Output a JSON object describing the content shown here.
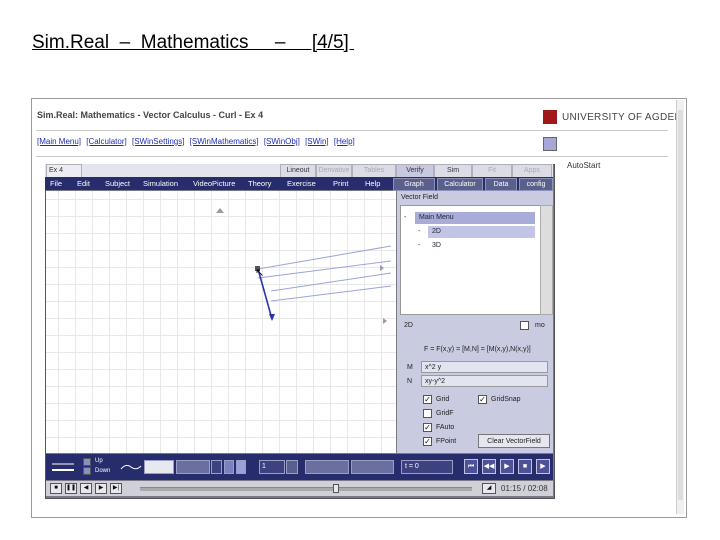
{
  "slide": {
    "title": "Sim.Real  –  Mathematics     –     [4/5] "
  },
  "app": {
    "title": "Sim.Real: Mathematics - Vector Calculus - Curl - Ex 4",
    "university": "UNIVERSITY OF AGDER",
    "nav_links": [
      "[Main Menu]",
      "[Calculator]",
      "[SWinSettings]",
      "[SWinMathematics]",
      "[SWinObj]",
      "[SWin]",
      "[Help]"
    ],
    "autostart": "AutoStart"
  },
  "tabs": [
    "Ex 4",
    "Lineout",
    "Derivative",
    "Tables",
    "Verify",
    "Sim",
    "Fit",
    "Apps"
  ],
  "menu": [
    "File",
    "Edit",
    "Subject",
    "Simulation",
    "VideoPicture",
    "Theory",
    "Exercise",
    "Print",
    "Help"
  ],
  "toolbar_buttons": [
    "Graph",
    "Calculator",
    "Data",
    "config"
  ],
  "right_panel": {
    "header": "Vector Field",
    "tree": [
      {
        "prefix": "-",
        "label": "Main Menu"
      },
      {
        "prefix": "-",
        "label": "2D"
      },
      {
        "prefix": "-",
        "label": "3D"
      }
    ],
    "mode_label": "2D",
    "mode_right": "mo",
    "formula": "F = F(x,y) = [M,N] = [M(x,y),N(x,y)]",
    "field_m_label": "M",
    "field_m_value": "x^2 y",
    "field_n_label": "N",
    "field_n_value": "xy-y^2",
    "checkboxes": [
      {
        "label": "Grid",
        "checked": true
      },
      {
        "label": "GridSnap",
        "checked": true
      },
      {
        "label": "GridF",
        "checked": false
      },
      {
        "label": "FAuto",
        "checked": true
      },
      {
        "label": "FPoint",
        "checked": true
      }
    ],
    "clear_button": "Clear VectorField"
  },
  "bottom": {
    "pen_labels": [
      "Up",
      "Down"
    ],
    "spinner_value": "1",
    "t_label": "t = 0"
  },
  "player": {
    "timecode": "01:15 / 02:08"
  },
  "icons": {
    "cursor": "mouse-pointer-icon",
    "logo": "university-logo-icon"
  },
  "colors": {
    "menubar": "#262c6c",
    "panel": "#c9cbe0",
    "link": "#1c2bb0",
    "vector": "#2a35a8"
  }
}
